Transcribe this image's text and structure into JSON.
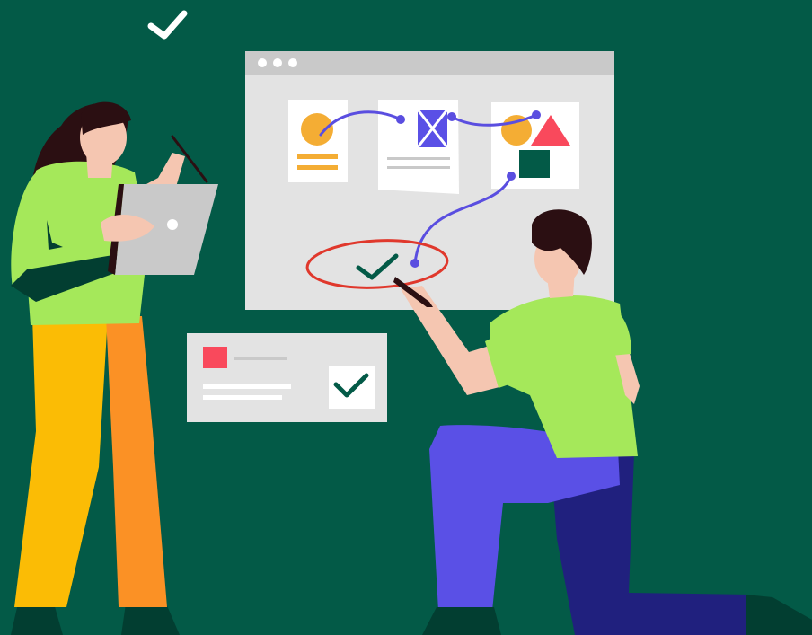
{
  "palette": {
    "background": "#035a47",
    "board": "#e3e3e3",
    "board_bar": "#c9c9c9",
    "card": "#ffffff",
    "shirt": "#a5e85a",
    "purple": "#5a50e6",
    "navy": "#20207e",
    "orange_light": "#fbbc05",
    "orange_dark": "#fb9125",
    "skin": "#f5c6b1",
    "hair": "#2b0f12",
    "accent_red": "#f9495c",
    "accent_yellow": "#f4ad34",
    "connector": "#5a4ee0",
    "ellipse_red": "#e0382c",
    "dark_green": "#035a47",
    "laptop": "#c9c9c9"
  },
  "icons": [
    "check-icon",
    "window-dots-icon",
    "image-card-icon",
    "wireframe-card-icon",
    "shapes-card-icon",
    "confirm-check-icon"
  ]
}
